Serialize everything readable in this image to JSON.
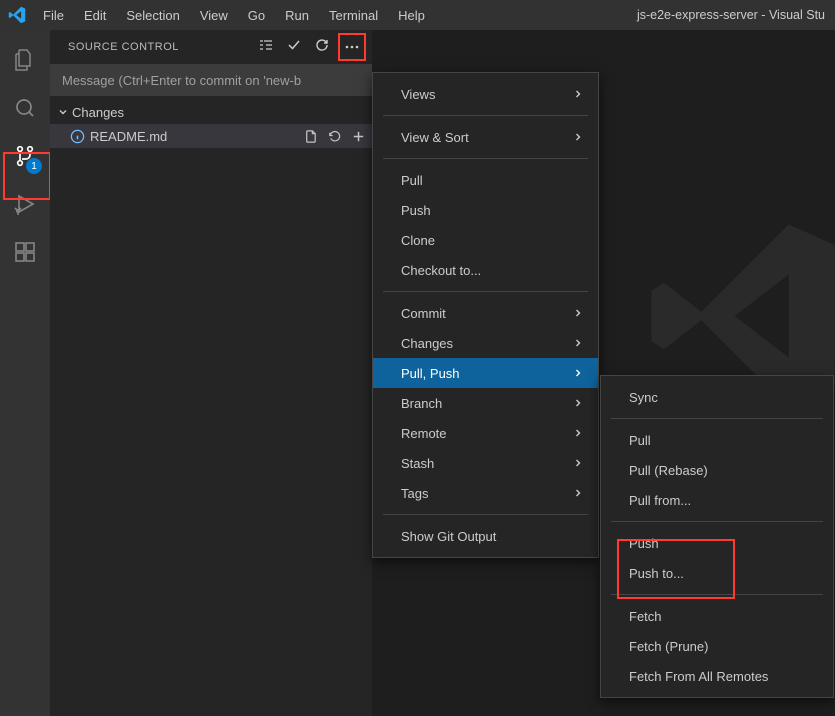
{
  "titlebar": {
    "menus": [
      "File",
      "Edit",
      "Selection",
      "View",
      "Go",
      "Run",
      "Terminal",
      "Help"
    ],
    "title": "js-e2e-express-server - Visual Stu"
  },
  "activitybar": {
    "badge": "1"
  },
  "source_control": {
    "title": "SOURCE CONTROL",
    "commit_placeholder": "Message (Ctrl+Enter to commit on 'new-b",
    "changes_label": "Changes",
    "file": "README.md"
  },
  "main_menu": {
    "views": "Views",
    "view_sort": "View & Sort",
    "pull": "Pull",
    "push": "Push",
    "clone": "Clone",
    "checkout": "Checkout to...",
    "commit": "Commit",
    "changes": "Changes",
    "pull_push": "Pull, Push",
    "branch": "Branch",
    "remote": "Remote",
    "stash": "Stash",
    "tags": "Tags",
    "show_git_output": "Show Git Output"
  },
  "sub_menu": {
    "sync": "Sync",
    "pull": "Pull",
    "pull_rebase": "Pull (Rebase)",
    "pull_from": "Pull from...",
    "push": "Push",
    "push_to": "Push to...",
    "fetch": "Fetch",
    "fetch_prune": "Fetch (Prune)",
    "fetch_all": "Fetch From All Remotes"
  }
}
